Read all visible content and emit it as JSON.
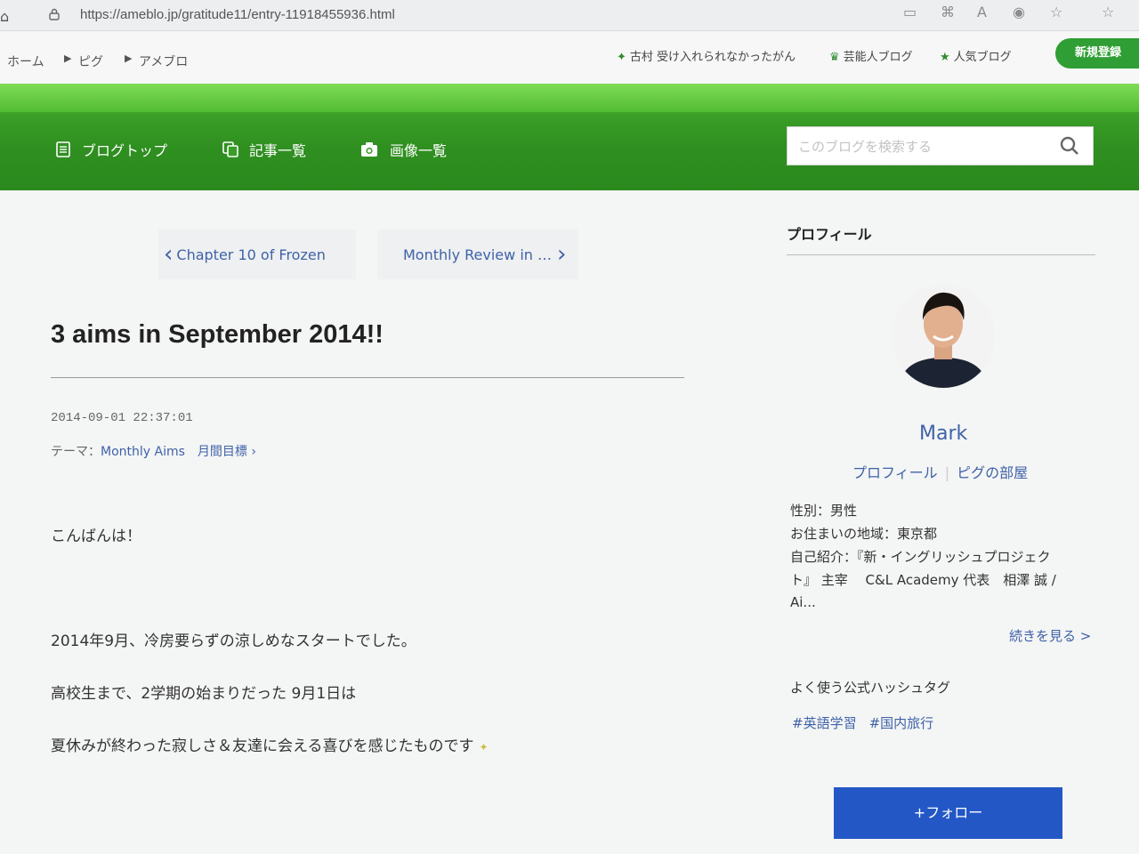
{
  "browser": {
    "url": "https://ameblo.jp/gratitude11/entry-11918455936.html"
  },
  "header": {
    "breadcrumbs": [
      "ホーム",
      "ピグ",
      "アメブロ"
    ],
    "links": [
      {
        "icon": "sparkle-icon",
        "label": "古村 受け入れられなかったがん"
      },
      {
        "icon": "crown-icon",
        "label": "芸能人ブログ"
      },
      {
        "icon": "star-icon",
        "label": "人気ブログ"
      }
    ],
    "register_label": "新規登録"
  },
  "blog_nav": {
    "items": [
      {
        "icon": "document-icon",
        "label": "ブログトップ"
      },
      {
        "icon": "copy-icon",
        "label": "記事一覧"
      },
      {
        "icon": "camera-icon",
        "label": "画像一覧"
      }
    ],
    "search_placeholder": "このブログを検索する"
  },
  "article": {
    "prev_label": "Chapter 10 of Frozen",
    "next_label": "Monthly Review in …",
    "title": "3 aims in September 2014!!",
    "date": "2014-09-01 22:37:01",
    "theme_prefix": "テーマ：",
    "theme": "Monthly Aims　月間目標",
    "paragraphs": [
      "こんばんは！",
      "2014年9月、冷房要らずの涼しめなスタートでした。",
      "高校生まで、2学期の始まりだった 9月1日は",
      "夏休みが終わった寂しさ＆友達に会える喜びを感じたものです"
    ]
  },
  "sidebar": {
    "profile_heading": "プロフィール",
    "name": "Mark",
    "profile_link": "プロフィール",
    "room_link": "ピグの部屋",
    "gender": "性別：男性",
    "location": "お住まいの地域：東京都",
    "intro_1": "自己紹介：『新・イングリッシュプロジェク",
    "intro_2": "ト』 主宰　 C&L Academy 代表　相澤 誠 /",
    "intro_3": "Ai...",
    "more_label": "続きを見る >",
    "hashtag_heading": "よく使う公式ハッシュタグ",
    "hashtags": [
      "#英語学習",
      "#国内旅行"
    ],
    "follow_label": "+フォロー"
  },
  "colors": {
    "brand_green": "#2f8f20",
    "link_blue": "#3f62a8",
    "follow_blue": "#2457c6"
  }
}
